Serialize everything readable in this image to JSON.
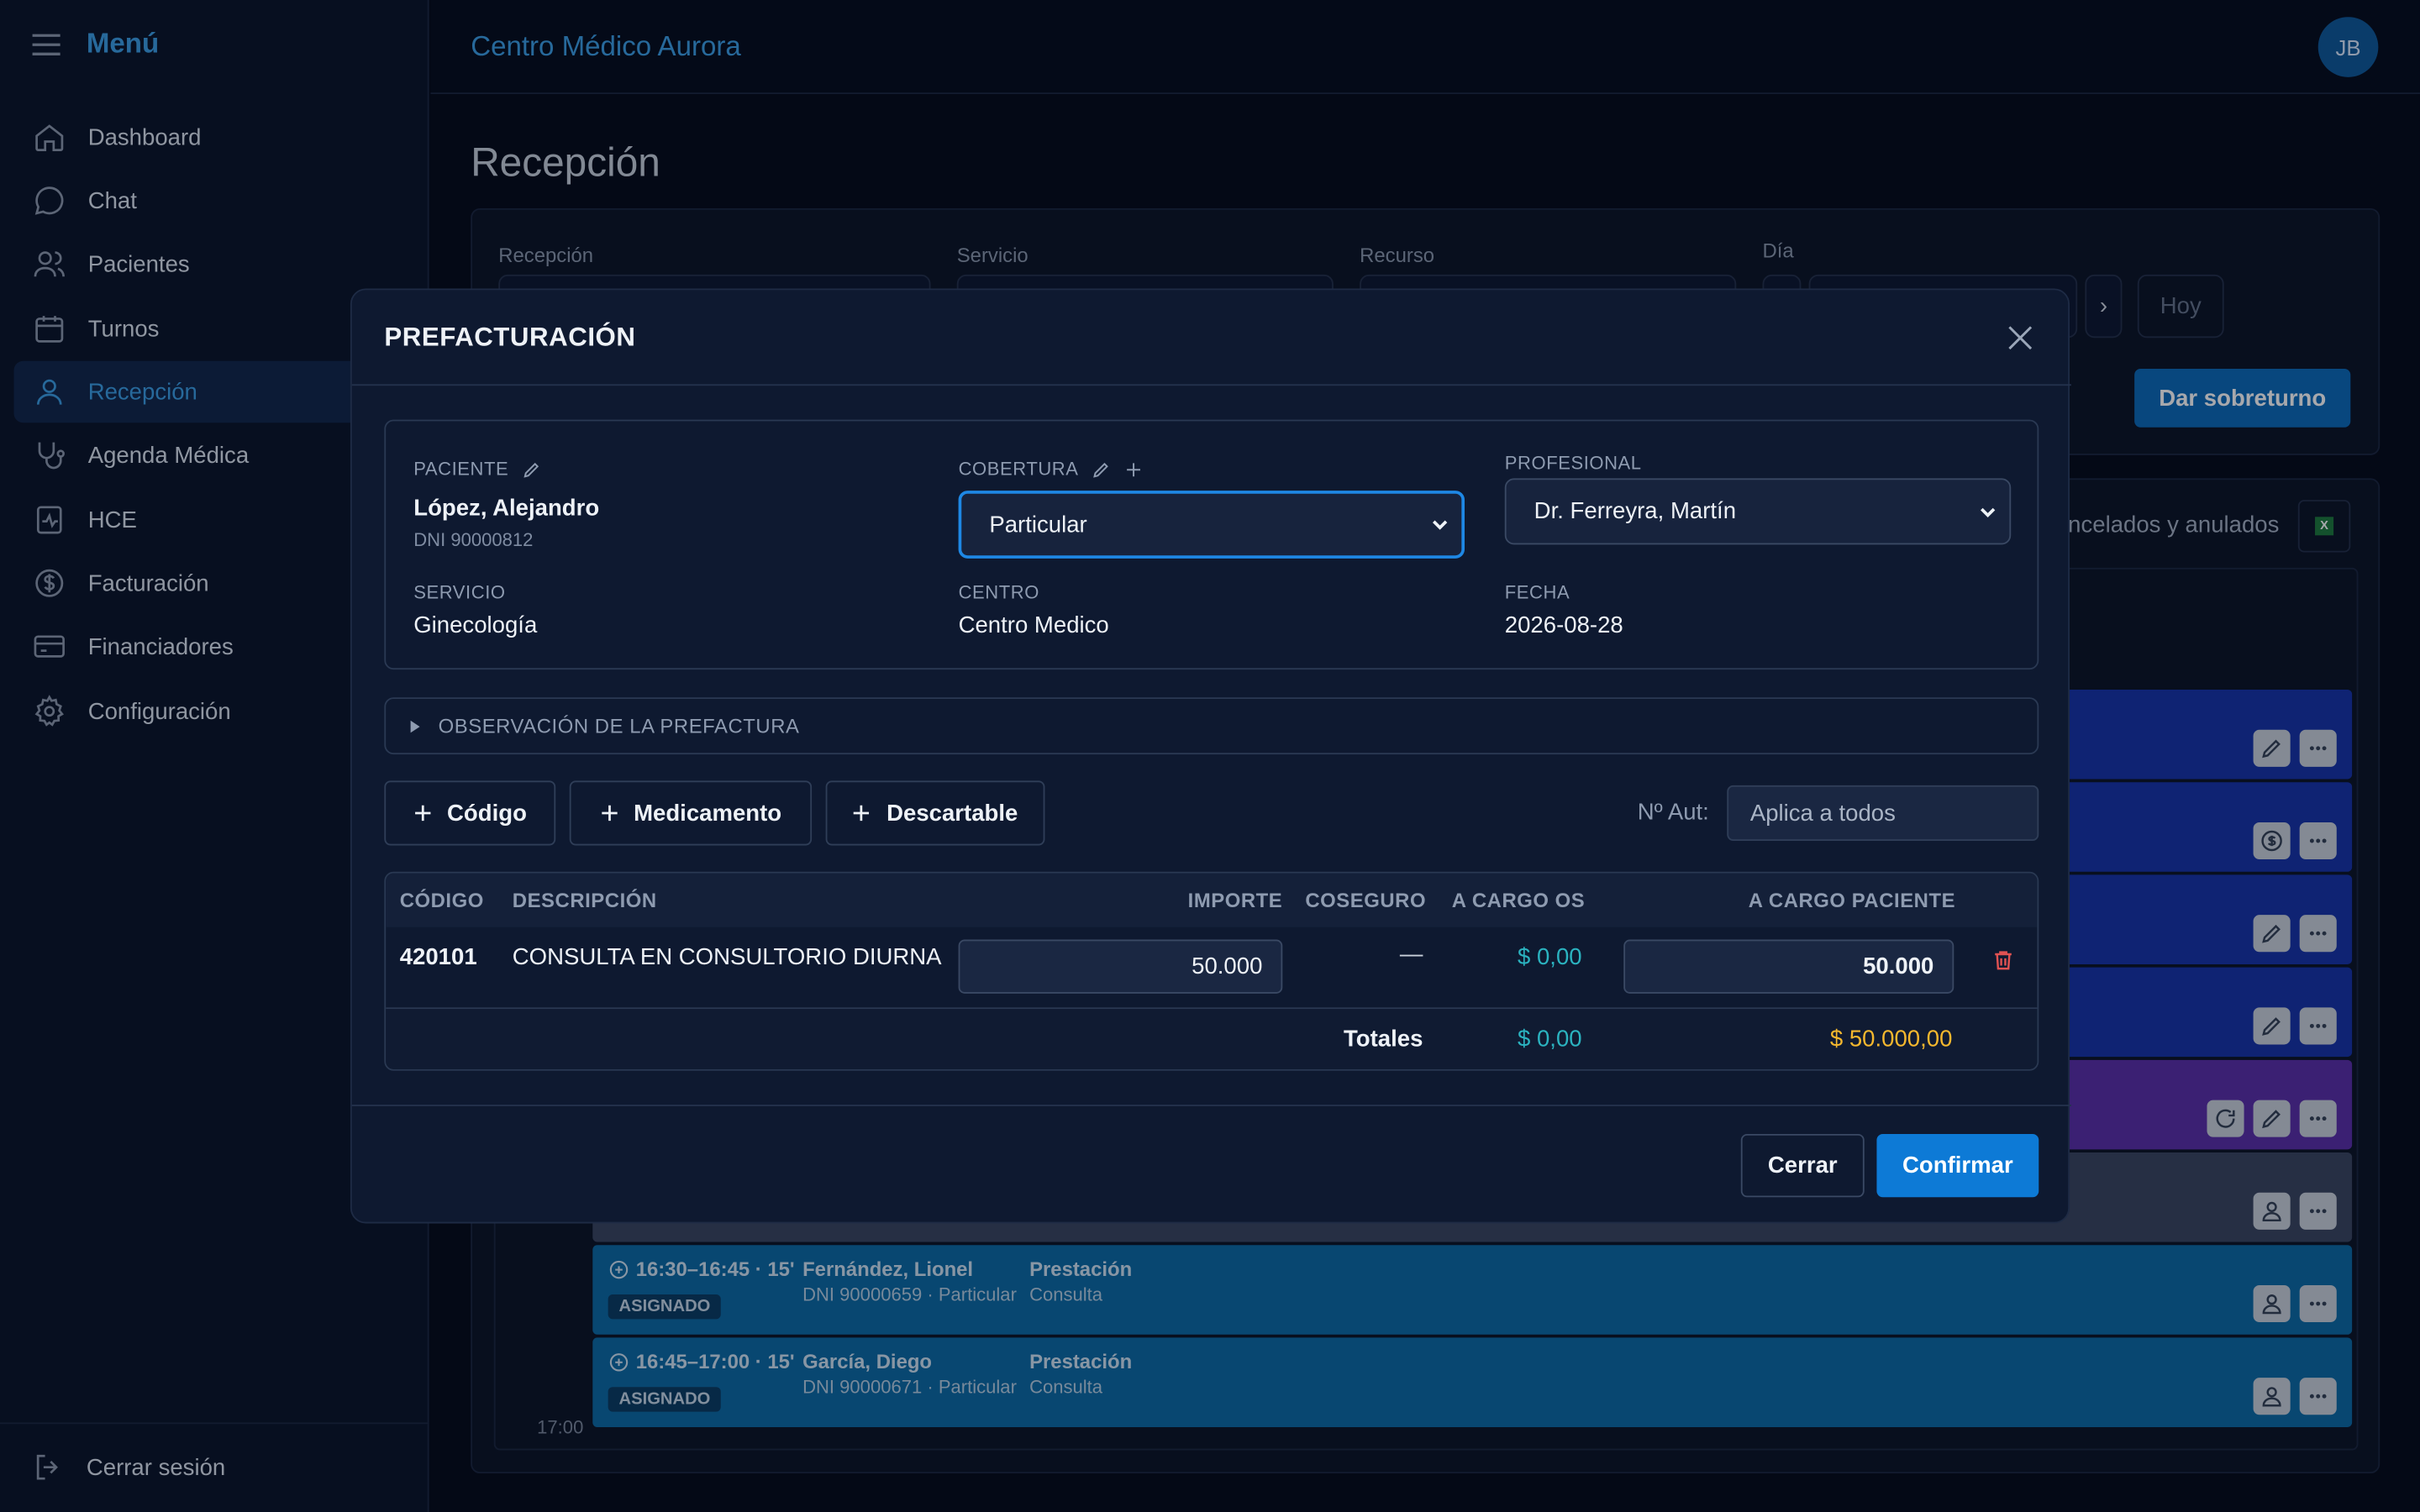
{
  "sidebar": {
    "menu_title": "Menú",
    "items": [
      {
        "label": "Dashboard",
        "icon": "home-icon"
      },
      {
        "label": "Chat",
        "icon": "chat-icon"
      },
      {
        "label": "Pacientes",
        "icon": "users-icon"
      },
      {
        "label": "Turnos",
        "icon": "calendar-icon"
      },
      {
        "label": "Recepción",
        "icon": "user-icon",
        "active": true
      },
      {
        "label": "Agenda Médica",
        "icon": "stethoscope-icon"
      },
      {
        "label": "HCE",
        "icon": "clipboard-icon"
      },
      {
        "label": "Facturación",
        "icon": "dollar-icon"
      },
      {
        "label": "Financiadores",
        "icon": "credit-card-icon"
      },
      {
        "label": "Configuración",
        "icon": "gear-icon"
      }
    ],
    "logout": "Cerrar sesión"
  },
  "topbar": {
    "brand": "Centro Médico Aurora",
    "avatar_initials": "JB"
  },
  "page": {
    "title": "Recepción",
    "filters": {
      "recepcion": "Recepción",
      "servicio": "Servicio",
      "recurso": "Recurso",
      "dia": "Día",
      "next": "›",
      "hoy": "Hoy"
    },
    "sobreturno_button": "Dar sobreturno",
    "cancelados_text": "ncelados y anulados",
    "time_label": "17:00",
    "appointments": [
      {
        "time": "16:30–16:45 · 15'",
        "status": "ASIGNADO",
        "name": "Fernández, Lionel",
        "sub": "DNI 90000659 · Particular",
        "type": "Prestación",
        "type_sub": "Consulta"
      },
      {
        "time": "16:45–17:00 · 15'",
        "status": "ASIGNADO",
        "name": "García, Diego",
        "sub": "DNI 90000671 · Particular",
        "type": "Prestación",
        "type_sub": "Consulta"
      }
    ]
  },
  "modal": {
    "title": "PREFACTURACIÓN",
    "paciente_label": "PACIENTE",
    "paciente_name": "López, Alejandro",
    "paciente_dni": "DNI 90000812",
    "cobertura_label": "COBERTURA",
    "cobertura_value": "Particular",
    "profesional_label": "PROFESIONAL",
    "profesional_value": "Dr. Ferreyra, Martín",
    "servicio_label": "SERVICIO",
    "servicio_value": "Ginecología",
    "centro_label": "CENTRO",
    "centro_value": "Centro Medico",
    "fecha_label": "FECHA",
    "fecha_value": "2026-08-28",
    "observacion_label": "OBSERVACIÓN DE LA PREFACTURA",
    "add_buttons": {
      "codigo": "Código",
      "medicamento": "Medicamento",
      "descartable": "Descartable"
    },
    "naut_label": "Nº Aut:",
    "naut_placeholder": "Aplica a todos",
    "table": {
      "headers": {
        "codigo": "CÓDIGO",
        "descripcion": "DESCRIPCIÓN",
        "importe": "IMPORTE",
        "coseguro": "COSEGURO",
        "cargo_os": "A CARGO OS",
        "cargo_paciente": "A CARGO PACIENTE"
      },
      "row": {
        "codigo": "420101",
        "descripcion": "CONSULTA EN CONSULTORIO DIURNA",
        "importe": "50.000",
        "coseguro": "—",
        "cargo_os": "$ 0,00",
        "cargo_paciente": "50.000"
      },
      "totales_label": "Totales",
      "total_os": "$ 0,00",
      "total_paciente": "$ 50.000,00"
    },
    "cerrar": "Cerrar",
    "confirmar": "Confirmar"
  },
  "colors": {
    "accent": "#3b9fe5",
    "primary_button": "#0d7ad6",
    "os_total": "#2bb3c0",
    "patient_total": "#f5b82e",
    "delete": "#e05252"
  }
}
